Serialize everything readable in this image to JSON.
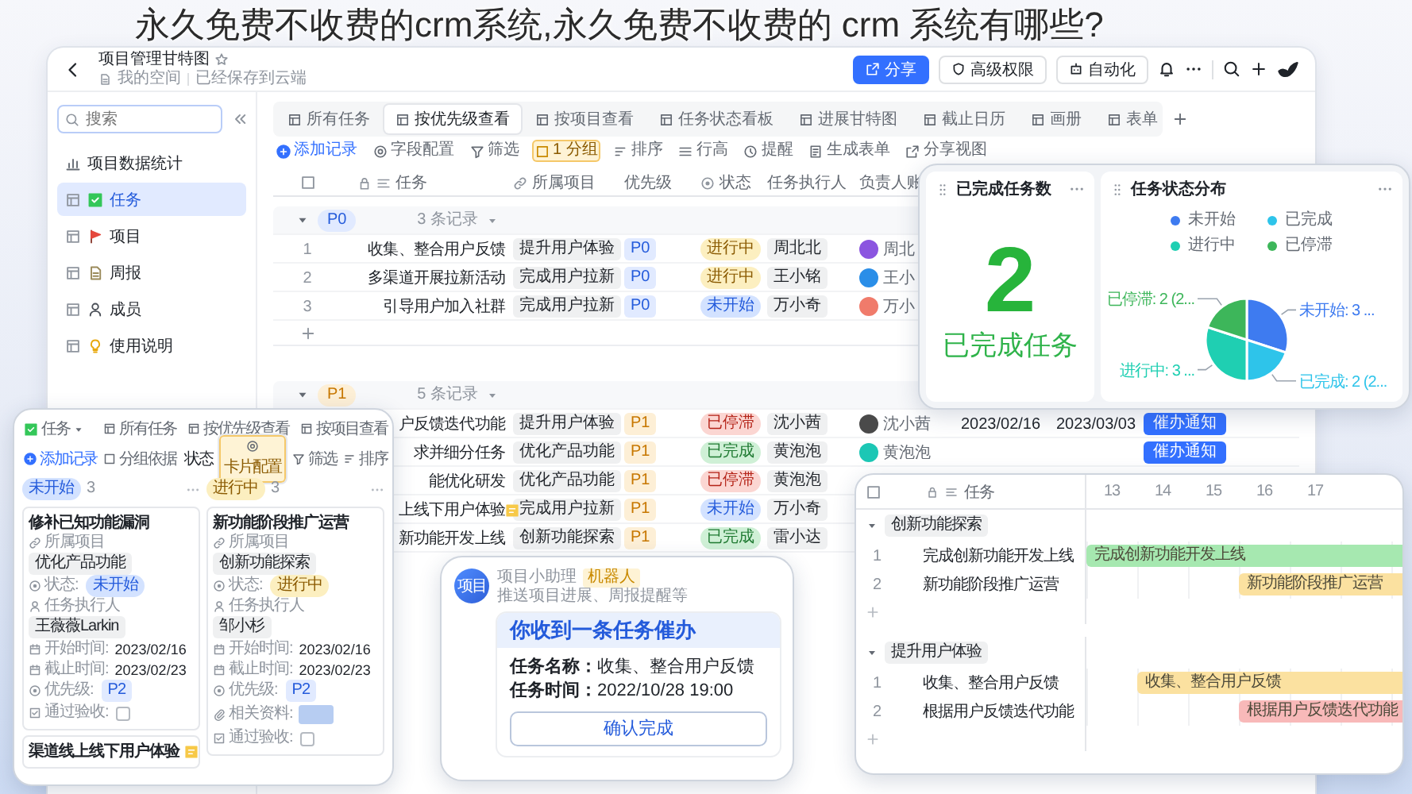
{
  "headline": "永久免费不收费的crm系统,永久免费不收费的 crm 系统有哪些?",
  "app": {
    "title": "项目管理甘特图",
    "starred": false,
    "location": "我的空间",
    "save_status": "已经保存到云端",
    "actions": [
      {
        "kind": "share",
        "label": "分享"
      },
      {
        "kind": "permission",
        "label": "高级权限"
      },
      {
        "kind": "automation",
        "label": "自动化"
      }
    ],
    "sidebar": {
      "search": {
        "placeholder": "搜索"
      },
      "items": [
        {
          "kind": "dashboard",
          "label": "项目数据统计",
          "selected": false
        },
        {
          "kind": "task",
          "label": "任务",
          "selected": true
        },
        {
          "kind": "project",
          "label": "项目",
          "selected": false
        },
        {
          "kind": "report",
          "label": "周报",
          "selected": false
        },
        {
          "kind": "member",
          "label": "成员",
          "selected": false
        },
        {
          "kind": "guide",
          "label": "使用说明",
          "selected": false
        }
      ]
    },
    "view_tabs": [
      {
        "label": "所有任务",
        "selected": false
      },
      {
        "label": "按优先级查看",
        "selected": true
      },
      {
        "label": "按项目查看",
        "selected": false
      },
      {
        "label": "任务状态看板",
        "selected": false
      },
      {
        "label": "进展甘特图",
        "selected": false
      },
      {
        "label": "截止日历",
        "selected": false
      },
      {
        "label": "画册",
        "selected": false
      },
      {
        "label": "表单",
        "selected": false
      }
    ],
    "toolbar": [
      {
        "kind": "add",
        "label": "添加记录"
      },
      {
        "kind": "fields",
        "label": "字段配置"
      },
      {
        "kind": "filter",
        "label": "筛选"
      },
      {
        "kind": "group",
        "label": "1 分组"
      },
      {
        "kind": "sort",
        "label": "排序"
      },
      {
        "kind": "height",
        "label": "行高"
      },
      {
        "kind": "remind",
        "label": "提醒"
      },
      {
        "kind": "form",
        "label": "生成表单"
      },
      {
        "kind": "share",
        "label": "分享视图"
      }
    ],
    "table": {
      "select_all": {
        "checked": false
      },
      "columns": [
        {
          "kind": "text",
          "label": "任务"
        },
        {
          "kind": "link",
          "label": "所属项目"
        },
        {
          "kind": "plain",
          "label": "优先级"
        },
        {
          "kind": "status",
          "label": "状态"
        },
        {
          "kind": "plain",
          "label": "任务执行人"
        },
        {
          "kind": "plain",
          "label": "负责人账"
        }
      ],
      "groups": [
        {
          "label": "P0",
          "kind": "p0",
          "count": "3 条记录",
          "expanded": true,
          "add_row": true,
          "rows": [
            {
              "number": "1",
              "task": "收集、整合用户反馈",
              "flagged": false,
              "project": "提升用户体验",
              "priority": {
                "label": "P0",
                "kind": "p0"
              },
              "status": {
                "label": "进行中",
                "kind": "doing"
              },
              "assignee": "周北北",
              "owner": {
                "name": "周北",
                "color": "#8b55e0"
              }
            },
            {
              "number": "2",
              "task": "多渠道开展拉新活动",
              "flagged": false,
              "project": "完成用户拉新",
              "priority": {
                "label": "P0",
                "kind": "p0"
              },
              "status": {
                "label": "进行中",
                "kind": "doing"
              },
              "assignee": "王小铭",
              "owner": {
                "name": "王小",
                "color": "#2a8ee8"
              }
            },
            {
              "number": "3",
              "task": "引导用户加入社群",
              "flagged": false,
              "project": "完成用户拉新",
              "priority": {
                "label": "P0",
                "kind": "p0"
              },
              "status": {
                "label": "未开始",
                "kind": "todo"
              },
              "assignee": "万小奇",
              "owner": {
                "name": "万小",
                "color": "#f07b6b"
              }
            }
          ]
        },
        {
          "label": "P1",
          "kind": "p1",
          "count": "5 条记录",
          "expanded": true,
          "add_row": false,
          "rows": [
            {
              "task": "户反馈迭代功能",
              "flagged": false,
              "project": "提升用户体验",
              "priority": {
                "label": "P1",
                "kind": "p1"
              },
              "status": {
                "label": "已停滞",
                "kind": "stalled"
              },
              "assignee": "沈小茜",
              "owner": {
                "name": "沈小茜",
                "color": "#4a4a4a"
              },
              "start": "2023/02/16",
              "end": "2023/03/03",
              "action": "催办通知"
            },
            {
              "task": "求并细分任务",
              "flagged": false,
              "project": "优化产品功能",
              "priority": {
                "label": "P1",
                "kind": "p1"
              },
              "status": {
                "label": "已完成",
                "kind": "done"
              },
              "assignee": "黄泡泡",
              "owner": {
                "name": "黄泡泡",
                "color": "#1cc7b5"
              },
              "action": "催办通知"
            },
            {
              "task": "能优化研发",
              "flagged": false,
              "project": "优化产品功能",
              "priority": {
                "label": "P1",
                "kind": "p1"
              },
              "status": {
                "label": "已停滞",
                "kind": "stalled"
              },
              "assignee": "黄泡泡"
            },
            {
              "task": "上线下用户体验",
              "flagged": true,
              "project": "完成用户拉新",
              "priority": {
                "label": "P1",
                "kind": "p1"
              },
              "status": {
                "label": "未开始",
                "kind": "todo"
              },
              "assignee": "万小奇"
            },
            {
              "task": "新功能开发上线",
              "flagged": false,
              "project": "创新功能探索",
              "priority": {
                "label": "P1",
                "kind": "p1"
              },
              "status": {
                "label": "已完成",
                "kind": "done"
              },
              "assignee": "雷小达"
            }
          ]
        }
      ]
    }
  },
  "stats": {
    "count_card": {
      "title": "已完成任务数",
      "value": "2",
      "caption": "已完成任务"
    },
    "status_card": {
      "title": "任务状态分布",
      "legend": [
        {
          "label": "未开始",
          "color": "#3e7bf0"
        },
        {
          "label": "已完成",
          "color": "#2ec4ea"
        },
        {
          "label": "进行中",
          "color": "#1fcfb2"
        },
        {
          "label": "已停滞",
          "color": "#3db65a"
        }
      ],
      "chart_data": {
        "type": "pie",
        "values": [
          3,
          2,
          3,
          2
        ],
        "value_labels": [
          "未开始: 3 ...",
          "已完成: 2 (2...",
          "进行中: 3 ...",
          "已停滞: 2 (2..."
        ]
      }
    }
  },
  "kanban": {
    "table_name": "任务",
    "tabs": [
      {
        "label": "所有任务",
        "selected": false
      },
      {
        "label": "按优先级查看",
        "selected": false
      },
      {
        "label": "按项目查看",
        "selected": false
      }
    ],
    "toolbar": [
      {
        "kind": "add",
        "label": "添加记录",
        "active": false
      },
      {
        "kind": "group",
        "label": "分组依据",
        "value": "状态",
        "active": false
      },
      {
        "kind": "card",
        "label": "卡片配置",
        "active": true
      },
      {
        "kind": "filter",
        "label": "筛选",
        "active": false
      },
      {
        "kind": "sort",
        "label": "排序",
        "active": false
      }
    ],
    "columns": [
      {
        "status": {
          "label": "未开始",
          "kind": "todo"
        },
        "count": "3",
        "cards": [
          {
            "title": "修补已知功能漏洞",
            "flagged": false,
            "fields": [
              {
                "kind": "project",
                "label": "所属项目",
                "value": "优化产品功能"
              },
              {
                "kind": "status",
                "label": "状态:",
                "value": {
                  "label": "未开始",
                  "kind": "todo"
                }
              },
              {
                "kind": "person",
                "label": "任务执行人",
                "value": "王薇薇Larkin"
              },
              {
                "kind": "date",
                "label": "开始时间:",
                "value": "2023/02/16"
              },
              {
                "kind": "date",
                "label": "截止时间:",
                "value": "2023/02/23"
              },
              {
                "kind": "priority",
                "label": "优先级:",
                "value": {
                  "label": "P2",
                  "kind": "p2"
                }
              },
              {
                "kind": "check",
                "label": "通过验收:",
                "checked": false
              }
            ]
          },
          {
            "title": "渠道线上线下用户体验",
            "flagged": true
          }
        ]
      },
      {
        "status": {
          "label": "进行中",
          "kind": "doing"
        },
        "count": "3",
        "cards": [
          {
            "title": "新功能阶段推广运营",
            "flagged": false,
            "fields": [
              {
                "kind": "project",
                "label": "所属项目",
                "value": "创新功能探索"
              },
              {
                "kind": "status",
                "label": "状态:",
                "value": {
                  "label": "进行中",
                  "kind": "doing"
                }
              },
              {
                "kind": "person",
                "label": "任务执行人",
                "value": "邹小杉"
              },
              {
                "kind": "date",
                "label": "开始时间:",
                "value": "2023/02/16"
              },
              {
                "kind": "date",
                "label": "截止时间:",
                "value": "2023/02/23"
              },
              {
                "kind": "priority",
                "label": "优先级:",
                "value": {
                  "label": "P2",
                  "kind": "p2"
                }
              },
              {
                "kind": "files",
                "label": "相关资料:"
              },
              {
                "kind": "check",
                "label": "通过验收:",
                "checked": false
              }
            ]
          }
        ]
      }
    ]
  },
  "notice": {
    "avatar": "项目",
    "sender": "项目小助理",
    "badge": "机器人",
    "description": "推送项目进展、周报提醒等",
    "heading": "你收到一条任务催办",
    "lines": [
      {
        "label": "任务名称：",
        "value": "收集、整合用户反馈"
      },
      {
        "label": "任务时间：",
        "value": "2022/10/28 19:00"
      }
    ],
    "button": "确认完成"
  },
  "gantt": {
    "select_all": {
      "checked": false
    },
    "column": "任务",
    "days": [
      "13",
      "14",
      "15",
      "16",
      "17"
    ],
    "groups": [
      {
        "label": "创新功能探索",
        "expanded": true,
        "rows": [
          {
            "number": "1",
            "task": "完成创新功能开发上线",
            "bar": {
              "label": "完成创新功能开发上线",
              "color": "#a6e8b0"
            }
          },
          {
            "number": "2",
            "task": "新功能阶段推广运营",
            "bar": {
              "label": "新功能阶段推广运营",
              "color": "#fbe1a0"
            }
          }
        ]
      },
      {
        "label": "提升用户体验",
        "expanded": true,
        "rows": [
          {
            "number": "1",
            "task": "收集、整合用户反馈",
            "bar": {
              "label": "收集、整合用户反馈",
              "color": "#fbe1a0"
            }
          },
          {
            "number": "2",
            "task": "根据用户反馈迭代功能",
            "bar": {
              "label": "根据用户反馈迭代功能",
              "color": "#f8b9b9"
            }
          }
        ]
      }
    ]
  }
}
